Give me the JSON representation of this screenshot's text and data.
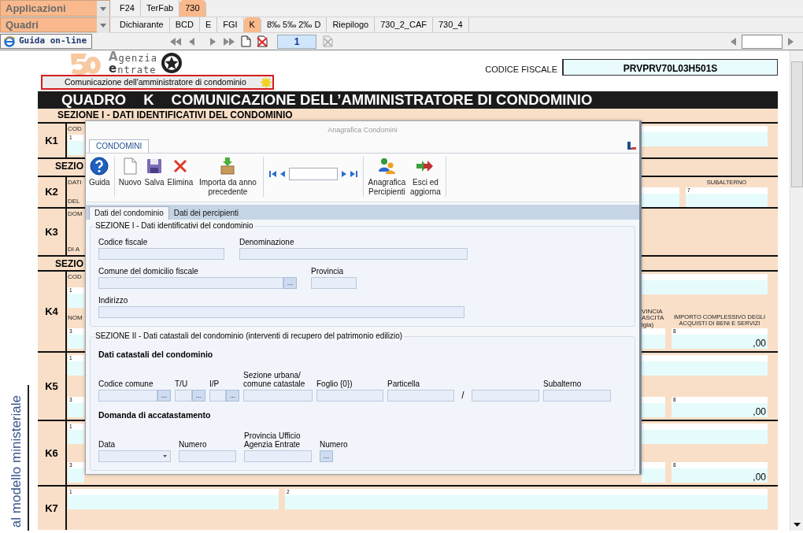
{
  "app_selector": "Applicazioni",
  "app_tabs": [
    {
      "label": "F24",
      "selected": false
    },
    {
      "label": "TerFab",
      "selected": false
    },
    {
      "label": "730",
      "selected": true
    }
  ],
  "section_selector": "Quadri",
  "section_tabs": [
    {
      "label": "Dichiarante",
      "selected": false
    },
    {
      "label": "BCD",
      "selected": false
    },
    {
      "label": "E",
      "selected": false
    },
    {
      "label": "FGI",
      "selected": false
    },
    {
      "label": "K",
      "selected": true
    },
    {
      "label": "8‰ 5‰ 2‰ D",
      "selected": false
    },
    {
      "label": "Riepilogo",
      "selected": false
    },
    {
      "label": "730_2_CAF",
      "selected": false
    },
    {
      "label": "730_4",
      "selected": false
    }
  ],
  "help_button": "Guida on-line",
  "page_number": "1",
  "form": {
    "logo": [
      "A",
      "genzia",
      "e",
      "ntrate"
    ],
    "section_button": "Comunicazione dell'amministratore di condominio",
    "codice_fiscale_label": "CODICE FISCALE",
    "codice_fiscale": "PRVPRV70L03H501S",
    "title": [
      "QUADRO",
      "K",
      "COMUNICAZIONE DELL’AMMINISTRATORE DI CONDOMINIO"
    ],
    "section": "SEZIONE I -  DATI IDENTIFICATIVI DEL CONDOMINIO",
    "rows": [
      {
        "kind": "row",
        "label": "K1",
        "left": [
          {
            "kind": "caption",
            "text": "COD"
          },
          {
            "kind": "field",
            "num": "1"
          }
        ],
        "right": [
          [
            [
              {
                "kind": "field"
              }
            ]
          ]
        ]
      },
      {
        "kind": "section",
        "label": "SEZIO"
      },
      {
        "kind": "row",
        "label": "K2",
        "left": [
          {
            "kind": "caption",
            "text": "DATI"
          },
          {
            "kind": "caption",
            "text": "DEL"
          }
        ],
        "right": [
          [
            [
              {
                "kind": "field"
              }
            ],
            [
              {
                "kind": "caption",
                "text": "SUBALTERNO"
              },
              {
                "kind": "field",
                "num": "7"
              }
            ]
          ]
        ]
      },
      {
        "kind": "row",
        "label": "K3",
        "left": [
          {
            "kind": "caption",
            "text": "DOM"
          },
          {
            "kind": "caption",
            "text": "DI A"
          }
        ]
      },
      {
        "kind": "section",
        "label": "SEZIO"
      },
      {
        "kind": "row",
        "label": "K4",
        "left": [
          {
            "kind": "caption",
            "text": "COD"
          },
          {
            "kind": "field",
            "num": "1"
          },
          {
            "kind": "caption",
            "text": "NOM"
          },
          {
            "kind": "field",
            "num": "3"
          }
        ],
        "right": [
          [
            [
              {
                "kind": "field"
              }
            ]
          ],
          [
            [
              {
                "kind": "caption",
                "text": "VINCIA"
              },
              {
                "kind": "caption",
                "text": "ASCITA"
              },
              {
                "kind": "caption",
                "text": "igla)"
              },
              {
                "kind": "field"
              }
            ],
            [
              {
                "kind": "caption",
                "text": "IMPORTO COMPLESSIVO DEGLI ACQUISTI DI BENI E SERVIZI"
              },
              {
                "kind": "field",
                "num": "8",
                "value": ",00"
              }
            ]
          ]
        ]
      },
      {
        "kind": "row",
        "label": "K5",
        "left": [
          {
            "kind": "field",
            "num": "1"
          },
          {
            "kind": "field",
            "num": "3"
          }
        ],
        "right": [
          [
            [
              {
                "kind": "field"
              }
            ]
          ],
          [
            [
              {
                "kind": "field"
              }
            ],
            [
              {
                "kind": "field",
                "num": "8",
                "value": ",00"
              }
            ]
          ]
        ]
      },
      {
        "kind": "row",
        "label": "K6",
        "left": [
          {
            "kind": "field",
            "num": "1"
          },
          {
            "kind": "field",
            "num": "3"
          }
        ],
        "right": [
          [
            [
              {
                "kind": "field"
              }
            ]
          ],
          [
            [
              {
                "kind": "field"
              }
            ],
            [
              {
                "kind": "field",
                "num": "8",
                "value": ",00"
              }
            ]
          ]
        ]
      },
      {
        "kind": "wide",
        "label": "K7",
        "lines": [
          [
            [
              {
                "kind": "field",
                "num": "1"
              }
            ],
            [
              {
                "kind": "field",
                "num": "2"
              }
            ]
          ]
        ]
      }
    ]
  },
  "margin_text": "al modello ministeriale",
  "dialog": {
    "title": "Anagrafica Condomini",
    "ribbon_tabs": [
      {
        "label": "CONDOMINI",
        "selected": true
      }
    ],
    "ribbon": [
      {
        "kind": "help",
        "label": "Guida"
      },
      {
        "kind": "separator"
      },
      {
        "kind": "new",
        "label": "Nuovo"
      },
      {
        "kind": "save",
        "label": "Salva"
      },
      {
        "kind": "delete",
        "label": "Elimina"
      },
      {
        "kind": "import",
        "label": "Importa da anno precedente"
      },
      {
        "kind": "separator"
      },
      {
        "kind": "navigator"
      },
      {
        "kind": "separator"
      },
      {
        "kind": "people",
        "label": "Anagrafica Percipienti"
      },
      {
        "kind": "exit",
        "label": "Esci ed aggiorna"
      },
      {
        "kind": "separator"
      }
    ],
    "tabs": [
      {
        "label": "Dati del condominio",
        "selected": true
      },
      {
        "label": "Dati dei percipienti",
        "selected": false
      }
    ],
    "sections": [
      {
        "legend": "SEZIONE I - Dati identificativi del condominio",
        "blocks": [
          {
            "fields": [
              {
                "kind": "text",
                "label": "Codice fiscale"
              },
              {
                "kind": "text",
                "label": "Denominazione"
              }
            ]
          },
          {
            "fields": [
              {
                "kind": "lookup",
                "label": "Comune del domicilio fiscale",
                "button": "..."
              },
              {
                "kind": "text",
                "label": "Provincia"
              }
            ]
          },
          {
            "fields": [
              {
                "kind": "text",
                "label": "Indirizzo"
              }
            ]
          }
        ]
      },
      {
        "legend": "SEZIONE II - Dati catastali del condominio (interventi di recupero del patrimonio edilizio)",
        "blocks": [
          {
            "heading": "Dati catastali del condominio",
            "fields": [
              {
                "kind": "lookup",
                "label": "Codice comune",
                "button": "..."
              },
              {
                "kind": "lookup",
                "label": "T/U",
                "button": "..."
              },
              {
                "kind": "lookup",
                "label": "I/P",
                "button": "..."
              },
              {
                "kind": "text",
                "label": "Sezione urbana/ comune catastale"
              },
              {
                "kind": "text",
                "label": "Foglio {0})"
              },
              {
                "kind": "text",
                "label": "Particella"
              },
              {
                "kind": "slash",
                "text": "/"
              },
              {
                "kind": "text"
              },
              {
                "kind": "text",
                "label": "Subalterno"
              }
            ]
          },
          {
            "heading": "Domanda di accatastamento",
            "fields": [
              {
                "kind": "date",
                "label": "Data"
              },
              {
                "kind": "text",
                "label": "Numero"
              },
              {
                "kind": "text",
                "label": "Provincia Ufficio Agenzia Entrate"
              },
              {
                "kind": "button",
                "label": "Numero",
                "button": "..."
              }
            ]
          }
        ]
      }
    ]
  }
}
